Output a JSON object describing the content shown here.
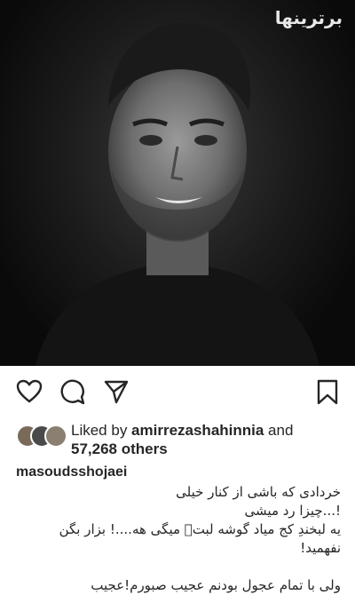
{
  "watermark": "برترینها",
  "actions": {
    "like_icon": "heart-icon",
    "comment_icon": "comment-icon",
    "share_icon": "share-icon",
    "save_icon": "bookmark-icon"
  },
  "likes": {
    "prefix": "Liked by ",
    "user": "amirrezashahinnia",
    "and": " and",
    "count": "57,268 others"
  },
  "caption": {
    "username": "masoudsshojaei",
    "lines": [
      "خردادی که باشی از کنار خیلی",
      "!...چیزا رد میشی",
      "یه لبخندِ کج میاد گوشه لبت٘ میگی هه....! بزار بگن",
      "نفهمید!",
      "",
      "ولی با تمام عجول بودنم عجیب صبورم!عجیب"
    ]
  }
}
